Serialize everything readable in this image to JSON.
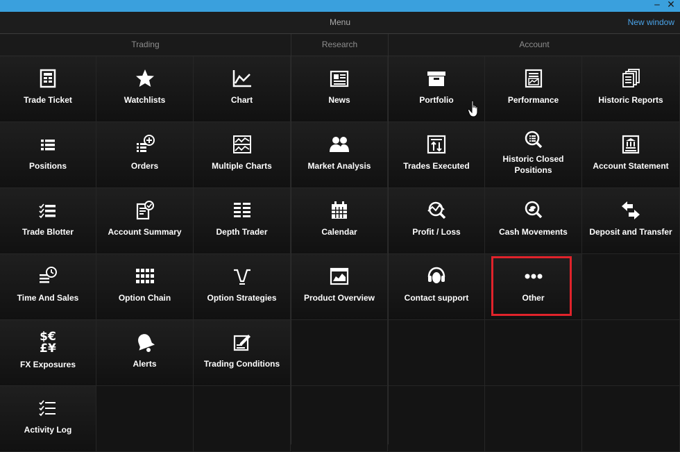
{
  "menubar": {
    "title": "Menu",
    "new_window": "New window"
  },
  "window_controls": {
    "minimize": "‒",
    "close": "✕"
  },
  "sections": {
    "trading": {
      "title": "Trading",
      "items": [
        {
          "label": "Trade Ticket",
          "icon": "trade-ticket-icon"
        },
        {
          "label": "Watchlists",
          "icon": "star-icon"
        },
        {
          "label": "Chart",
          "icon": "line-chart-icon"
        },
        {
          "label": "Positions",
          "icon": "list-icon"
        },
        {
          "label": "Orders",
          "icon": "orders-icon"
        },
        {
          "label": "Multiple Charts",
          "icon": "multiple-charts-icon"
        },
        {
          "label": "Trade Blotter",
          "icon": "checklist-icon"
        },
        {
          "label": "Account Summary",
          "icon": "account-summary-icon"
        },
        {
          "label": "Depth Trader",
          "icon": "depth-trader-icon"
        },
        {
          "label": "Time And Sales",
          "icon": "time-and-sales-icon"
        },
        {
          "label": "Option Chain",
          "icon": "option-chain-icon"
        },
        {
          "label": "Option Strategies",
          "icon": "option-strategies-icon"
        },
        {
          "label": "FX Exposures",
          "icon": "fx-exposures-icon"
        },
        {
          "label": "Alerts",
          "icon": "bell-icon"
        },
        {
          "label": "Trading Conditions",
          "icon": "trading-conditions-icon"
        },
        {
          "label": "Activity Log",
          "icon": "activity-log-icon"
        }
      ]
    },
    "research": {
      "title": "Research",
      "items": [
        {
          "label": "News",
          "icon": "newspaper-icon"
        },
        {
          "label": "Market Analysis",
          "icon": "people-icon"
        },
        {
          "label": "Calendar",
          "icon": "calendar-icon"
        },
        {
          "label": "Product Overview",
          "icon": "product-overview-icon"
        }
      ]
    },
    "account": {
      "title": "Account",
      "items": [
        {
          "label": "Portfolio",
          "icon": "portfolio-icon"
        },
        {
          "label": "Performance",
          "icon": "performance-icon"
        },
        {
          "label": "Historic Reports",
          "icon": "historic-reports-icon"
        },
        {
          "label": "Trades Executed",
          "icon": "trades-executed-icon"
        },
        {
          "label": "Historic Closed Positions",
          "icon": "historic-closed-positions-icon"
        },
        {
          "label": "Account Statement",
          "icon": "account-statement-icon"
        },
        {
          "label": "Profit / Loss",
          "icon": "profit-loss-icon"
        },
        {
          "label": "Cash Movements",
          "icon": "cash-movements-icon"
        },
        {
          "label": "Deposit and Transfer",
          "icon": "deposit-transfer-icon"
        },
        {
          "label": "Contact support",
          "icon": "headset-icon"
        },
        {
          "label": "Other",
          "icon": "more-icon"
        }
      ]
    }
  },
  "fx_glyphs": {
    "top": "$€",
    "bottom": "£¥"
  },
  "colors": {
    "accent": "#3aa0dd",
    "link": "#4aa3e8",
    "highlight": "#e0232b",
    "background": "#161616"
  }
}
